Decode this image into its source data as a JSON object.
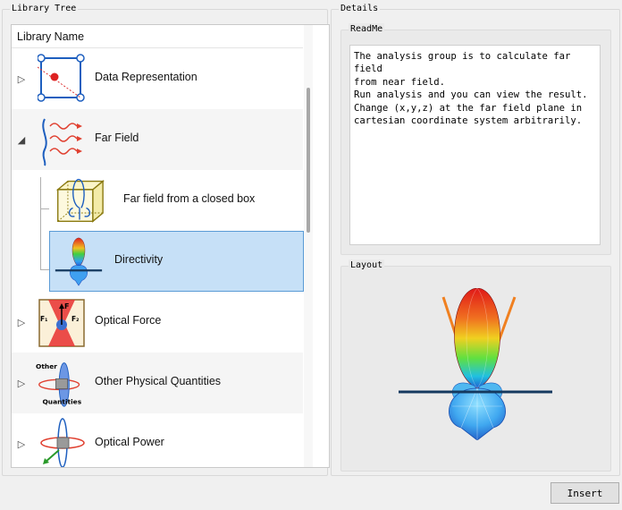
{
  "library_tree": {
    "title": "Library Tree",
    "column_header": "Library Name",
    "items": [
      {
        "label": "Data Representation",
        "icon": "data-representation-icon"
      },
      {
        "label": "Far Field",
        "icon": "far-field-icon"
      },
      {
        "label": "Far field from a closed box",
        "icon": "closed-box-icon"
      },
      {
        "label": "Directivity",
        "icon": "directivity-icon"
      },
      {
        "label": "Optical Force",
        "icon": "optical-force-icon",
        "icon_text_f": "F",
        "icon_text_f1": "F₁",
        "icon_text_f2": "F₂"
      },
      {
        "label": "Other Physical Quantities",
        "icon": "other-quantities-icon",
        "icon_text_top": "Other",
        "icon_text_bottom": "Quantities"
      },
      {
        "label": "Optical Power",
        "icon": "optical-power-icon"
      }
    ]
  },
  "details": {
    "title": "Details",
    "readme_title": "ReadMe",
    "readme_text": "The analysis group is to calculate far field\nfrom near field.\nRun analysis and you can view the result.\nChange (x,y,z) at the far field plane in\ncartesian coordinate system arbitrarily.",
    "layout_title": "Layout"
  },
  "insert_button": {
    "label": "Insert"
  },
  "colors": {
    "selection_fill": "#c6e0f7",
    "selection_border": "#5a9bd6"
  }
}
